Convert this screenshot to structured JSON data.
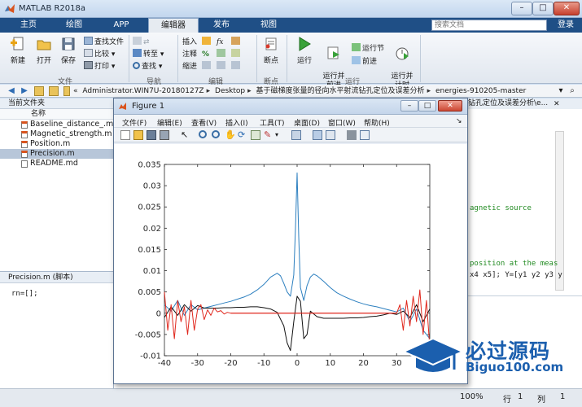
{
  "window": {
    "title": "MATLAB R2018a",
    "min": "–",
    "max": "□",
    "close": "✕"
  },
  "tabs": [
    {
      "label": "主页"
    },
    {
      "label": "绘图"
    },
    {
      "label": "APP"
    },
    {
      "label": "编辑器"
    },
    {
      "label": "发布"
    },
    {
      "label": "视图"
    }
  ],
  "search": {
    "placeholder": "搜索文档"
  },
  "login": "登录",
  "ribbon": {
    "file": {
      "new": "新建",
      "open": "打开",
      "save": "保存",
      "find_files": "查找文件",
      "compare": "比较",
      "print": "打印",
      "group": "文件"
    },
    "navigate": {
      "goto": "转至",
      "find": "查找",
      "group": "导航"
    },
    "edit": {
      "insert": "插入",
      "comment": "注释",
      "indent": "缩进",
      "fx": "fx",
      "group": "编辑"
    },
    "breakpoints": {
      "breakpoints": "断点",
      "group": "断点"
    },
    "run": {
      "run": "运行",
      "run_advance": "运行并\n前进",
      "run_section": "运行节",
      "advance": "前进",
      "run_time": "运行并\n计时",
      "group": "运行"
    }
  },
  "breadcrumb": [
    "«",
    "Administrator.WIN7U-20180127Z",
    "Desktop",
    "基于磁梯度张量的径向水平射流钻孔定位及误差分析",
    "energies-910205-master"
  ],
  "filepanel": {
    "title": "当前文件夹",
    "column": "名称",
    "files": [
      {
        "name": "Baseline_distance_.m"
      },
      {
        "name": "Magnetic_strength.m"
      },
      {
        "name": "Position.m"
      },
      {
        "name": "Precision.m"
      },
      {
        "name": "README.md"
      }
    ]
  },
  "detail": {
    "title": "Precision.m (脚本)",
    "code": "rn=[];"
  },
  "editor": {
    "title": "钻孔定位及误差分析\\e...",
    "lines": [
      "agnetic source",
      "position at the meas",
      "x4 x5]; Y=[y1 y2 y3 y"
    ]
  },
  "statusbar": {
    "zoom": "100%",
    "row_label": "行",
    "row": "1",
    "col_label": "列",
    "col": "1"
  },
  "figure": {
    "title": "Figure 1",
    "menus": [
      "文件(F)",
      "编辑(E)",
      "查看(V)",
      "插入(I)",
      "工具(T)",
      "桌面(D)",
      "窗口(W)",
      "帮助(H)"
    ]
  },
  "watermark": {
    "cn": "必过源码",
    "en": "Biguo100.com"
  },
  "colors": {
    "blue": "#2c7fbf",
    "black": "#111111",
    "red": "#e0281e",
    "accent": "#1f4f86"
  },
  "chart_data": {
    "type": "line",
    "xlim": [
      -40,
      40
    ],
    "ylim": [
      -0.01,
      0.035
    ],
    "xticks": [
      -40,
      -30,
      -20,
      -10,
      0,
      10,
      20,
      30
    ],
    "yticks": [
      -0.01,
      -0.005,
      0,
      0.005,
      0.01,
      0.015,
      0.02,
      0.025,
      0.03,
      0.035
    ],
    "ytick_labels": [
      "-0.01",
      "-0.005",
      "0",
      "0.005",
      "0.01",
      "0.015",
      "0.02",
      "0.025",
      "0.03",
      "0.035"
    ],
    "grid": false,
    "series": [
      {
        "color": "#2c7fbf",
        "x": [
          -40,
          -38,
          -36,
          -34,
          -32,
          -30,
          -28,
          -26,
          -24,
          -22,
          -20,
          -18,
          -16,
          -14,
          -12,
          -10,
          -8,
          -6,
          -5,
          -4,
          -3,
          -2,
          -1,
          -0.5,
          0,
          0.5,
          1,
          2,
          3,
          4,
          5,
          6,
          8,
          10,
          12,
          14,
          16,
          18,
          20,
          22,
          24,
          26,
          28,
          30,
          32,
          34,
          36,
          38,
          40
        ],
        "y": [
          0.002,
          0.0005,
          0.003,
          -0.0005,
          0.002,
          0.0008,
          0.0012,
          0.0016,
          0.002,
          0.0024,
          0.0028,
          0.0033,
          0.0038,
          0.0045,
          0.0055,
          0.0068,
          0.0085,
          0.0094,
          0.0088,
          0.007,
          0.005,
          0.004,
          0.009,
          0.02,
          0.033,
          0.018,
          0.006,
          0.003,
          0.0065,
          0.0085,
          0.0092,
          0.0088,
          0.0075,
          0.006,
          0.0048,
          0.004,
          0.0033,
          0.0027,
          0.0022,
          0.0018,
          0.0015,
          0.0011,
          0.0007,
          0.0003,
          0.0012,
          -0.002,
          0.001,
          -0.004,
          -0.006
        ]
      },
      {
        "color": "#111111",
        "x": [
          -40,
          -38,
          -36,
          -34,
          -32,
          -30,
          -28,
          -26,
          -24,
          -22,
          -20,
          -18,
          -16,
          -14,
          -12,
          -10,
          -8,
          -6,
          -4,
          -3,
          -2,
          -1,
          0,
          1,
          2,
          3,
          4,
          6,
          8,
          10,
          12,
          14,
          16,
          18,
          20,
          22,
          24,
          26,
          28,
          30,
          32,
          34,
          36,
          38,
          40
        ],
        "y": [
          -0.001,
          0.0015,
          -0.0005,
          0.002,
          0.0005,
          0.0018,
          0.0012,
          0.0012,
          0.0012,
          0.0013,
          0.0013,
          0.0014,
          0.0014,
          0.0015,
          0.0015,
          0.0013,
          0.001,
          0.0002,
          -0.003,
          -0.007,
          -0.0088,
          -0.002,
          0.004,
          0.0028,
          -0.006,
          -0.005,
          0.0005,
          -0.0008,
          -0.0012,
          -0.0012,
          -0.0012,
          -0.0012,
          -0.0011,
          -0.0011,
          -0.001,
          -0.0008,
          -0.0007,
          -0.0004,
          0,
          -0.0003,
          0.0005,
          -0.001,
          0.002,
          -0.002,
          0.001
        ]
      },
      {
        "color": "#e0281e",
        "x": [
          -40,
          -39,
          -38,
          -37,
          -36,
          -35,
          -34,
          -33,
          -32,
          -31,
          -30,
          -29,
          -28,
          -27,
          -26,
          -25,
          -24,
          -23,
          -22,
          -21,
          -20,
          30,
          31,
          32,
          33,
          34,
          35,
          36,
          37,
          38,
          39,
          40
        ],
        "y": [
          0.005,
          -0.004,
          0.002,
          -0.006,
          0.003,
          -0.002,
          0.0015,
          -0.005,
          0.003,
          -0.004,
          0.001,
          0.002,
          -0.0015,
          0.0008,
          -0.0005,
          0.0012,
          0.0003,
          0.0006,
          -0.0002,
          0.0002,
          0,
          0,
          0.002,
          -0.004,
          0.003,
          -0.003,
          0.004,
          -0.002,
          0.0055,
          -0.005,
          0.003,
          -0.008
        ]
      },
      {
        "color": "#e0281e",
        "x": [
          -20,
          30
        ],
        "y": [
          0,
          0
        ]
      }
    ]
  }
}
